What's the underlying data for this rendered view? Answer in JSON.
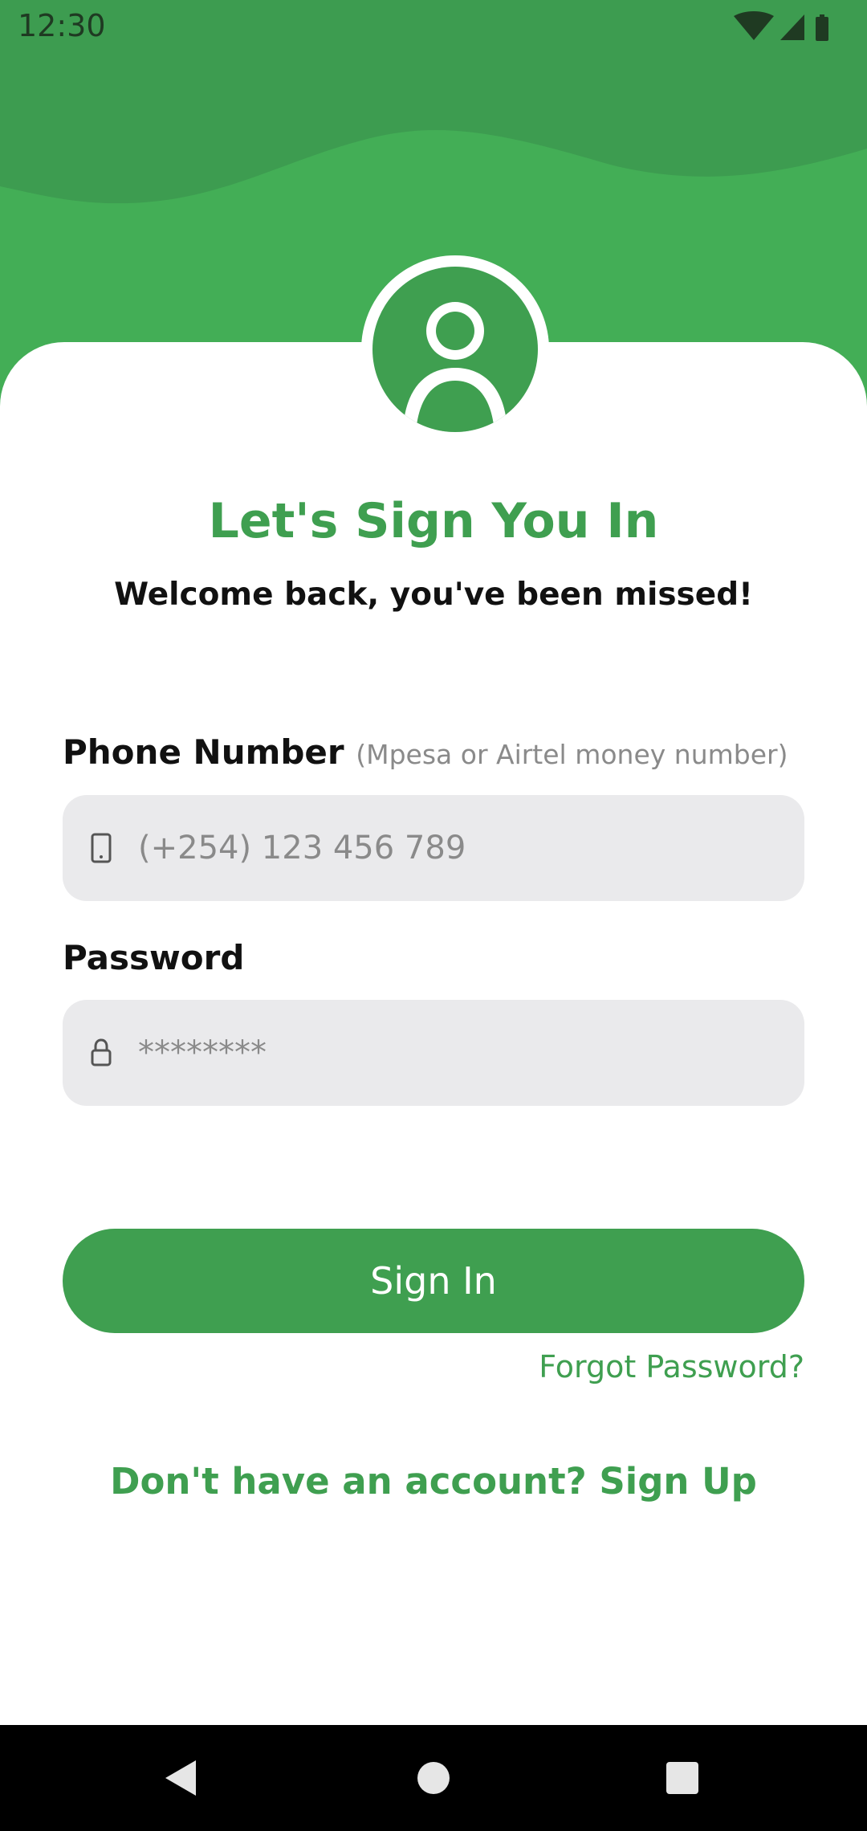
{
  "status_bar": {
    "time": "12:30",
    "icons": [
      "wifi-icon",
      "signal-icon",
      "battery-icon"
    ]
  },
  "header": {
    "avatar_icon": "user-avatar-icon"
  },
  "main": {
    "title": "Let's Sign You In",
    "subtitle": "Welcome back, you've been missed!",
    "phone": {
      "label": "Phone Number",
      "hint": "(Mpesa or Airtel money number)",
      "placeholder": "(+254) 123 456 789",
      "icon": "phone-icon"
    },
    "password": {
      "label": "Password",
      "placeholder": "********",
      "icon": "lock-icon"
    },
    "sign_in_label": "Sign In",
    "forgot_label": "Forgot Password?",
    "signup_label": "Don't have an account? Sign Up"
  },
  "nav_bar": {
    "buttons": [
      "back-icon",
      "home-icon",
      "recents-icon"
    ]
  },
  "colors": {
    "brand_green": "#3f9f50",
    "header_green": "#43ae56",
    "field_bg": "#eaeaec"
  }
}
